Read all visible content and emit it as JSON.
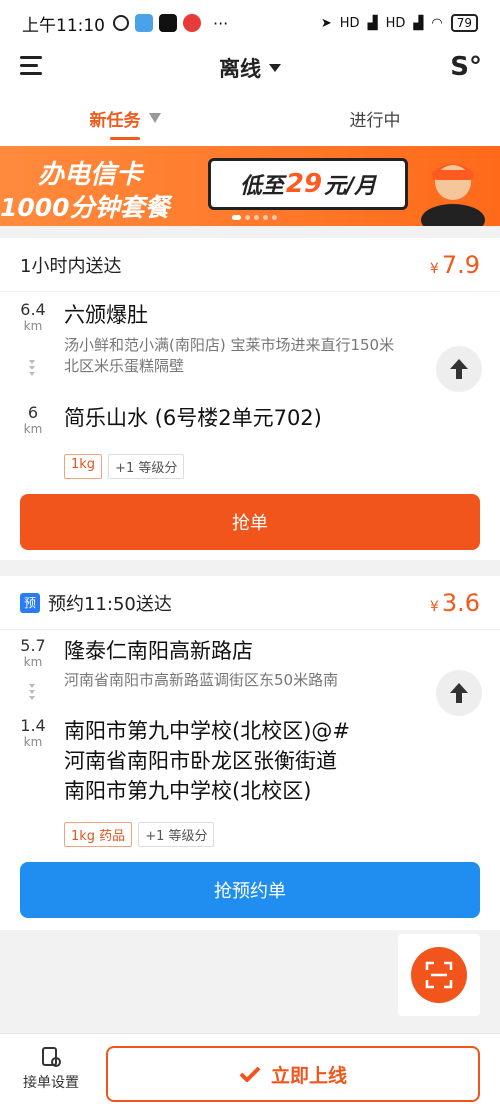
{
  "status_bar": {
    "time": "上午11:10",
    "signal_label": "HD",
    "battery": "79"
  },
  "header": {
    "title": "离线"
  },
  "tabs": [
    {
      "label": "新任务"
    },
    {
      "label": "进行中"
    }
  ],
  "banner": {
    "line1": "办电信卡",
    "line2": "1000分钟套餐",
    "bubble_pre": "低至",
    "bubble_num": "29",
    "bubble_post": "元/月"
  },
  "orders": [
    {
      "header": "1小时内送达",
      "currency": "¥",
      "price": "7.9",
      "pickup": {
        "dist": "6.4",
        "unit": "km",
        "name": "六颁爆肚",
        "address": "汤小鲜和范小满(南阳店) 宝莱市场进来直行150米北区米乐蛋糕隔壁"
      },
      "dropoff": {
        "dist": "6",
        "unit": "km",
        "name": "简乐山水 (6号楼2单元702)"
      },
      "tags": [
        "1kg",
        "+1 等级分"
      ],
      "action": "抢单"
    },
    {
      "header_badge": "预",
      "header": "预约11:50送达",
      "currency": "¥",
      "price": "3.6",
      "pickup": {
        "dist": "5.7",
        "unit": "km",
        "name": "隆泰仁南阳高新路店",
        "address": "河南省南阳市高新路蓝调街区东50米路南"
      },
      "dropoff": {
        "dist": "1.4",
        "unit": "km",
        "name_lines": [
          "南阳市第九中学校(北校区)@#",
          "河南省南阳市卧龙区张衡街道",
          "南阳市第九中学校(北校区)"
        ]
      },
      "tags": [
        "1kg  药品",
        "+1 等级分"
      ],
      "action": "抢预约单"
    }
  ],
  "bottom": {
    "settings_label": "接单设置",
    "online_label": "立即上线"
  },
  "colors": {
    "accent": "#f2551b",
    "blue": "#1f8ef0"
  }
}
